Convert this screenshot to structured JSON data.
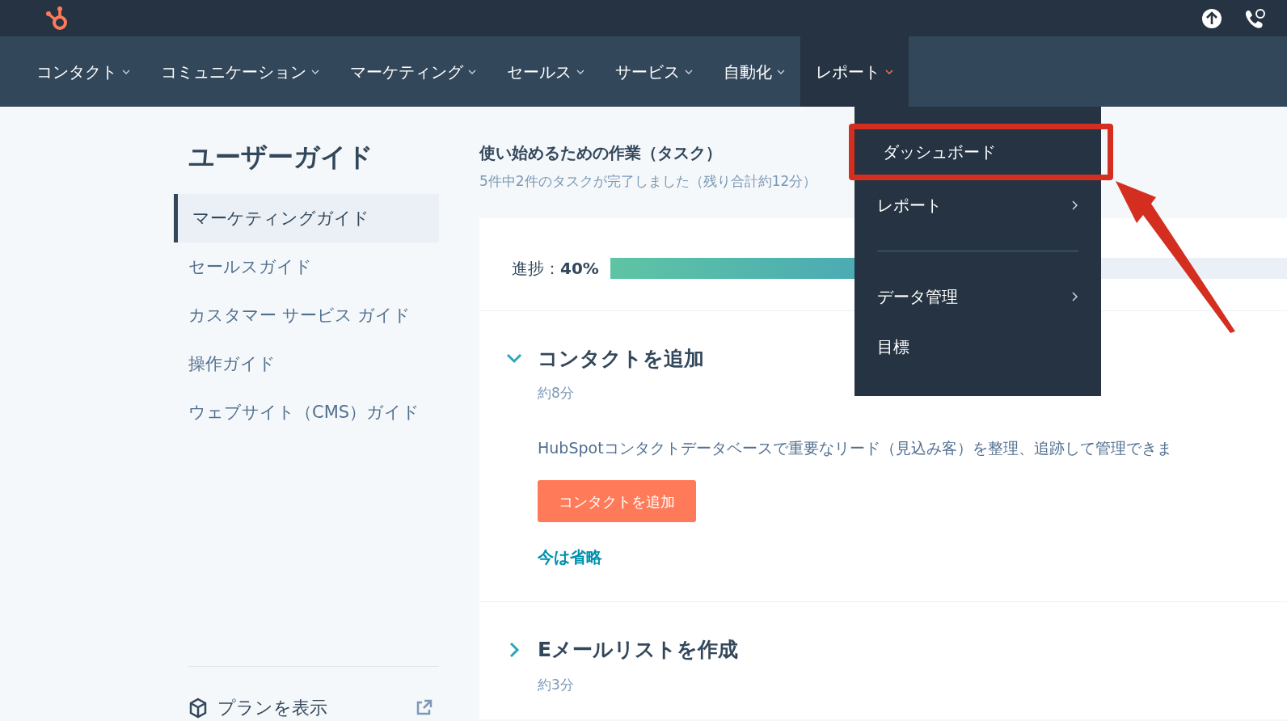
{
  "nav": [
    {
      "label": "コンタクト",
      "selected": false
    },
    {
      "label": "コミュニケーション",
      "selected": false
    },
    {
      "label": "マーケティング",
      "selected": false
    },
    {
      "label": "セールス",
      "selected": false
    },
    {
      "label": "サービス",
      "selected": false
    },
    {
      "label": "自動化",
      "selected": false
    },
    {
      "label": "レポート",
      "selected": true
    }
  ],
  "dropdown": {
    "items": [
      {
        "kind": "item",
        "label": "ダッシュボード",
        "submenu": false,
        "highlighted": true
      },
      {
        "kind": "item",
        "label": "レポート",
        "submenu": true,
        "highlighted": false
      },
      {
        "kind": "divider"
      },
      {
        "kind": "item",
        "label": "データ管理",
        "submenu": true,
        "highlighted": false
      },
      {
        "kind": "item",
        "label": "目標",
        "submenu": false,
        "highlighted": false
      }
    ]
  },
  "sidebar": {
    "title": "ユーザーガイド",
    "items": [
      {
        "label": "マーケティングガイド",
        "selected": true
      },
      {
        "label": "セールスガイド",
        "selected": false
      },
      {
        "label": "カスタマー サービス ガイド",
        "selected": false
      },
      {
        "label": "操作ガイド",
        "selected": false
      },
      {
        "label": "ウェブサイト（CMS）ガイド",
        "selected": false
      }
    ],
    "footer_link": "プランを表示"
  },
  "tasks": {
    "title": "使い始めるための作業（タスク）",
    "subtitle": "5件中2件のタスクが完了しました（残り合計約12分）",
    "progress_label": "進捗：",
    "progress_value": "40%",
    "level": 0.4,
    "sections": [
      {
        "title": "コンタクトを追加",
        "time": "約8分",
        "expanded": true,
        "description": "HubSpotコンタクトデータベースで重要なリード（見込み客）を整理、追跡して管理できま",
        "button": "コンタクトを追加",
        "skip_link": "今は省略"
      },
      {
        "title": "Eメールリストを作成",
        "time": "約3分",
        "expanded": false
      }
    ]
  }
}
